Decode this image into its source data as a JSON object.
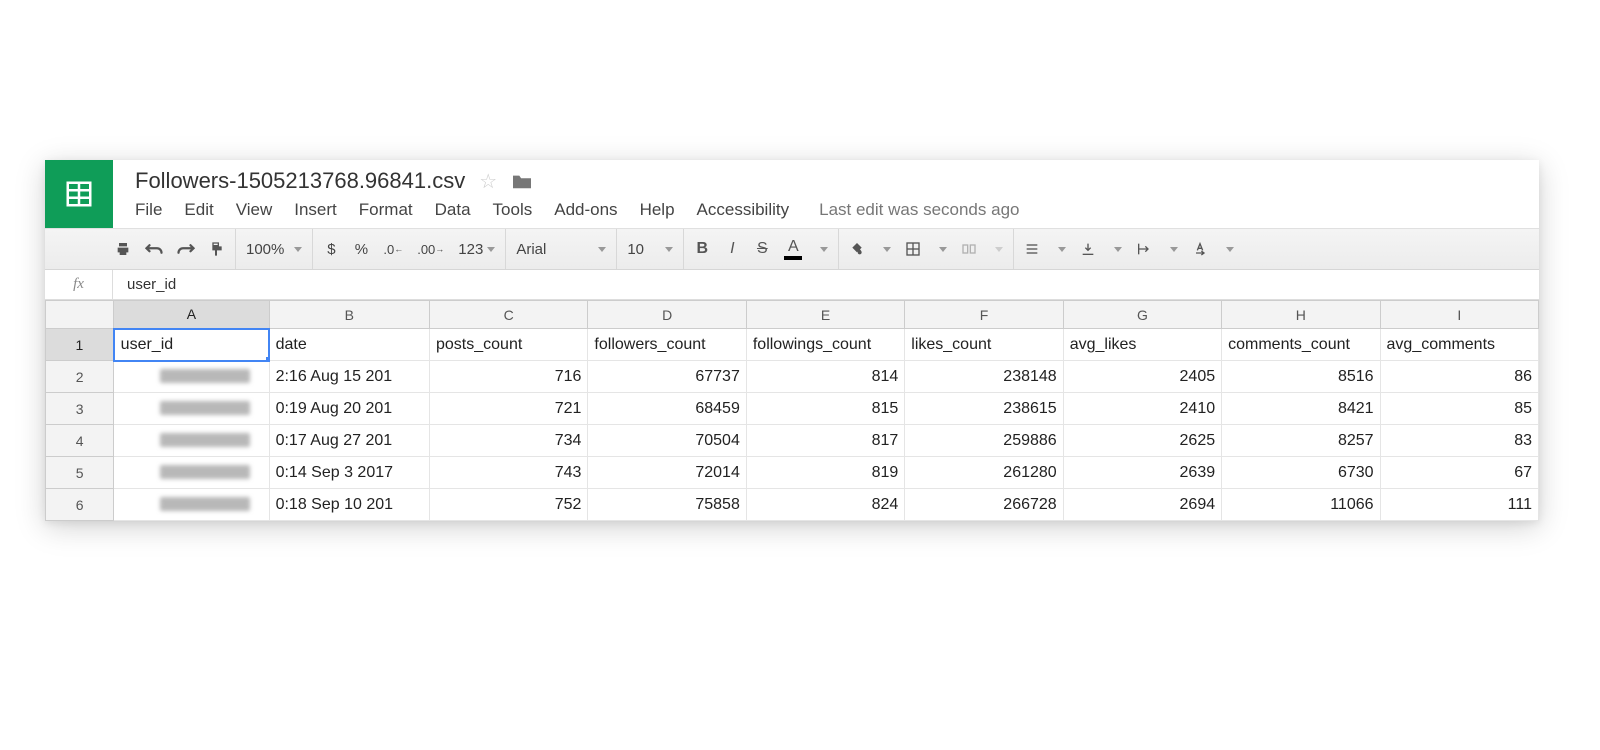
{
  "header": {
    "title": "Followers-1505213768.96841.csv"
  },
  "menu": {
    "items": [
      "File",
      "Edit",
      "View",
      "Insert",
      "Format",
      "Data",
      "Tools",
      "Add-ons",
      "Help",
      "Accessibility"
    ],
    "last_edit": "Last edit was seconds ago"
  },
  "toolbar": {
    "zoom": "100%",
    "currency": "$",
    "percent": "%",
    "dec_dec": ".0",
    "inc_dec": ".00",
    "more_formats": "123",
    "font": "Arial",
    "font_size": "10",
    "bold": "B",
    "italic": "I",
    "strike": "S",
    "text_color": "A"
  },
  "formula": {
    "fx": "fx",
    "value": "user_id"
  },
  "columns": [
    "A",
    "B",
    "C",
    "D",
    "E",
    "F",
    "G",
    "H",
    "I"
  ],
  "row_numbers": [
    "1",
    "2",
    "3",
    "4",
    "5",
    "6"
  ],
  "headers_row": [
    "user_id",
    "date",
    "posts_count",
    "followers_count",
    "followings_count",
    "likes_count",
    "avg_likes",
    "comments_count",
    "avg_comments"
  ],
  "rows": [
    {
      "date": "2:16 Aug 15 201",
      "posts_count": "716",
      "followers_count": "67737",
      "followings_count": "814",
      "likes_count": "238148",
      "avg_likes": "2405",
      "comments_count": "8516",
      "avg_comments": "86"
    },
    {
      "date": "0:19 Aug 20 201",
      "posts_count": "721",
      "followers_count": "68459",
      "followings_count": "815",
      "likes_count": "238615",
      "avg_likes": "2410",
      "comments_count": "8421",
      "avg_comments": "85"
    },
    {
      "date": "0:17 Aug 27 201",
      "posts_count": "734",
      "followers_count": "70504",
      "followings_count": "817",
      "likes_count": "259886",
      "avg_likes": "2625",
      "comments_count": "8257",
      "avg_comments": "83"
    },
    {
      "date": "0:14 Sep 3 2017",
      "posts_count": "743",
      "followers_count": "72014",
      "followings_count": "819",
      "likes_count": "261280",
      "avg_likes": "2639",
      "comments_count": "6730",
      "avg_comments": "67"
    },
    {
      "date": "0:18 Sep 10 201",
      "posts_count": "752",
      "followers_count": "75858",
      "followings_count": "824",
      "likes_count": "266728",
      "avg_likes": "2694",
      "comments_count": "11066",
      "avg_comments": "111"
    }
  ]
}
